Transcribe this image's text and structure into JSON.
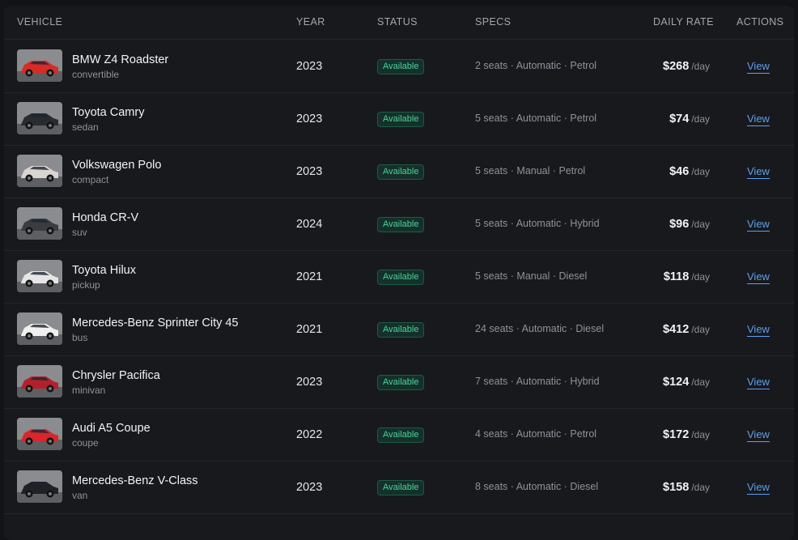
{
  "table": {
    "headers": {
      "vehicle": "Vehicle",
      "year": "Year",
      "status": "Status",
      "specs": "Specs",
      "daily_rate": "Daily Rate",
      "actions": "Actions"
    },
    "rows": [
      {
        "name": "BMW Z4 Roadster",
        "type": "convertible",
        "year": "2023",
        "status": "Available",
        "specs": "2 seats · Automatic · Petrol",
        "rate": "$268",
        "unit": "/day",
        "action": "View",
        "thumb_color": "#d92b25"
      },
      {
        "name": "Toyota Camry",
        "type": "sedan",
        "year": "2023",
        "status": "Available",
        "specs": "5 seats · Automatic · Petrol",
        "rate": "$74",
        "unit": "/day",
        "action": "View",
        "thumb_color": "#2a2b2e"
      },
      {
        "name": "Volkswagen Polo",
        "type": "compact",
        "year": "2023",
        "status": "Available",
        "specs": "5 seats · Manual · Petrol",
        "rate": "$46",
        "unit": "/day",
        "action": "View",
        "thumb_color": "#d9d6cf"
      },
      {
        "name": "Honda CR-V",
        "type": "suv",
        "year": "2024",
        "status": "Available",
        "specs": "5 seats · Automatic · Hybrid",
        "rate": "$96",
        "unit": "/day",
        "action": "View",
        "thumb_color": "#3b3c3f"
      },
      {
        "name": "Toyota Hilux",
        "type": "pickup",
        "year": "2021",
        "status": "Available",
        "specs": "5 seats · Manual · Diesel",
        "rate": "$118",
        "unit": "/day",
        "action": "View",
        "thumb_color": "#e6e6e6"
      },
      {
        "name": "Mercedes-Benz Sprinter City 45",
        "type": "bus",
        "year": "2021",
        "status": "Available",
        "specs": "24 seats · Automatic · Diesel",
        "rate": "$412",
        "unit": "/day",
        "action": "View",
        "thumb_color": "#f0f0f0"
      },
      {
        "name": "Chrysler Pacifica",
        "type": "minivan",
        "year": "2023",
        "status": "Available",
        "specs": "7 seats · Automatic · Hybrid",
        "rate": "$124",
        "unit": "/day",
        "action": "View",
        "thumb_color": "#b3202a"
      },
      {
        "name": "Audi A5 Coupe",
        "type": "coupe",
        "year": "2022",
        "status": "Available",
        "specs": "4 seats · Automatic · Petrol",
        "rate": "$172",
        "unit": "/day",
        "action": "View",
        "thumb_color": "#d8262b"
      },
      {
        "name": "Mercedes-Benz V-Class",
        "type": "van",
        "year": "2023",
        "status": "Available",
        "specs": "8 seats · Automatic · Diesel",
        "rate": "$158",
        "unit": "/day",
        "action": "View",
        "thumb_color": "#202124"
      }
    ]
  },
  "colors": {
    "available": "#4ed39a",
    "link": "#5b9ff0"
  }
}
